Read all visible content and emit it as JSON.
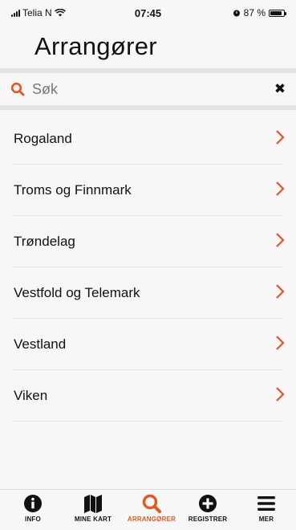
{
  "status": {
    "carrier": "Telia N",
    "time": "07:45",
    "battery_text": "87 %",
    "battery_level": 0.87
  },
  "header": {
    "title": "Arrangører"
  },
  "search": {
    "placeholder": "Søk",
    "value": ""
  },
  "regions": [
    {
      "label": "Rogaland"
    },
    {
      "label": "Troms og Finnmark"
    },
    {
      "label": "Trøndelag"
    },
    {
      "label": "Vestfold og Telemark"
    },
    {
      "label": "Vestland"
    },
    {
      "label": "Viken"
    }
  ],
  "tabbar": {
    "tabs": [
      {
        "label": "INFO",
        "icon": "info-icon"
      },
      {
        "label": "MINE KART",
        "icon": "map-icon"
      },
      {
        "label": "ARRANGØRER",
        "icon": "search-icon",
        "active": true
      },
      {
        "label": "REGISTRER",
        "icon": "plus-circle-icon"
      },
      {
        "label": "MER",
        "icon": "menu-icon"
      }
    ]
  },
  "colors": {
    "accent": "#e8561f",
    "text": "#111111",
    "background": "#f7f7f7"
  }
}
